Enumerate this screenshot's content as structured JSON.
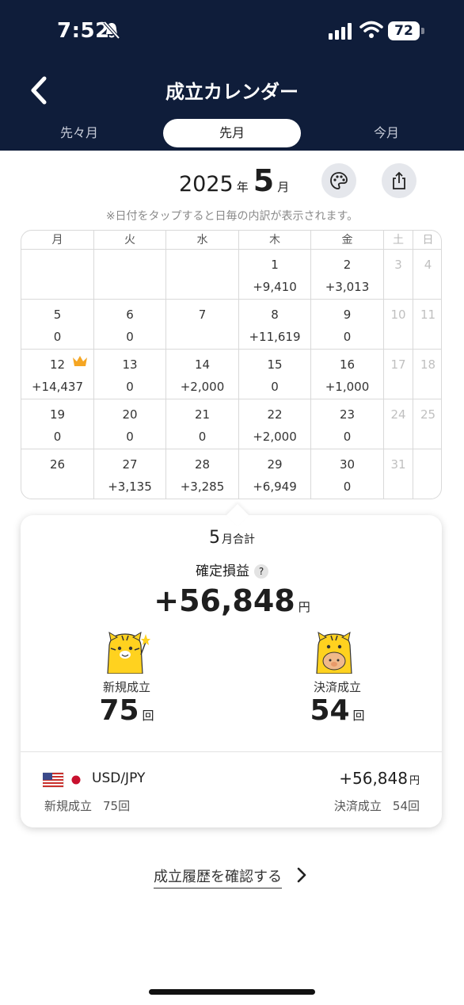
{
  "status_bar": {
    "time": "7:52",
    "battery": "72"
  },
  "header": {
    "title": "成立カレンダー"
  },
  "tabs": [
    {
      "label": "先々月",
      "selected": false
    },
    {
      "label": "先月",
      "selected": true
    },
    {
      "label": "今月",
      "selected": false
    }
  ],
  "month": {
    "year": "2025",
    "year_unit": "年",
    "month": "5",
    "month_unit": "月"
  },
  "note": "※日付をタップすると日毎の内訳が表示されます。",
  "calendar": {
    "weekdays": [
      "月",
      "火",
      "水",
      "木",
      "金",
      "土",
      "日"
    ],
    "weeks": [
      [
        {
          "day": "",
          "value": ""
        },
        {
          "day": "",
          "value": ""
        },
        {
          "day": "",
          "value": ""
        },
        {
          "day": "1",
          "value": "+9,410"
        },
        {
          "day": "2",
          "value": "+3,013"
        },
        {
          "day": "3",
          "value": ""
        },
        {
          "day": "4",
          "value": ""
        }
      ],
      [
        {
          "day": "5",
          "value": "0"
        },
        {
          "day": "6",
          "value": "0"
        },
        {
          "day": "7",
          "value": ""
        },
        {
          "day": "8",
          "value": "+11,619"
        },
        {
          "day": "9",
          "value": "0"
        },
        {
          "day": "10",
          "value": ""
        },
        {
          "day": "11",
          "value": ""
        }
      ],
      [
        {
          "day": "12",
          "value": "+14,437"
        },
        {
          "day": "13",
          "value": "0"
        },
        {
          "day": "14",
          "value": "+2,000"
        },
        {
          "day": "15",
          "value": "0"
        },
        {
          "day": "16",
          "value": "+1,000"
        },
        {
          "day": "17",
          "value": ""
        },
        {
          "day": "18",
          "value": ""
        }
      ],
      [
        {
          "day": "19",
          "value": "0"
        },
        {
          "day": "20",
          "value": "0"
        },
        {
          "day": "21",
          "value": "0"
        },
        {
          "day": "22",
          "value": "+2,000"
        },
        {
          "day": "23",
          "value": "0"
        },
        {
          "day": "24",
          "value": ""
        },
        {
          "day": "25",
          "value": ""
        }
      ],
      [
        {
          "day": "26",
          "value": ""
        },
        {
          "day": "27",
          "value": "+3,135"
        },
        {
          "day": "28",
          "value": "+3,285"
        },
        {
          "day": "29",
          "value": "+6,949"
        },
        {
          "day": "30",
          "value": "0"
        },
        {
          "day": "31",
          "value": ""
        },
        {
          "day": "",
          "value": ""
        }
      ]
    ]
  },
  "summary": {
    "month": "5",
    "month_label": "月合計",
    "pl_label": "確定損益",
    "help": "?",
    "pl_value": "+56,848",
    "yen": "円",
    "new_label": "新規成立",
    "new_count": "75",
    "close_label": "決済成立",
    "close_count": "54",
    "count_unit": "回"
  },
  "pair": {
    "name": "USD/JPY",
    "pl": "+56,848",
    "yen": "円",
    "new_label": "新規成立",
    "new_count": "75回",
    "close_label": "決済成立",
    "close_count": "54回"
  },
  "history_link": "成立履歴を確認する",
  "colors": {
    "header_bg": "#0f1d3a",
    "crown": "#f5a623"
  }
}
